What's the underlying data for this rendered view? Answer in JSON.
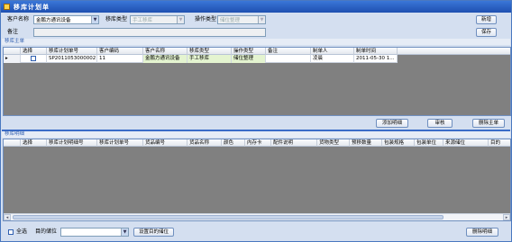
{
  "window": {
    "title": "移库计划单"
  },
  "form": {
    "customer_name_label": "客户名称",
    "customer_name_value": "金鹏方通讯设备",
    "move_type_label": "移库类型",
    "move_type_value": "手工移库",
    "op_type_label": "操作类型",
    "op_type_value": "储位整理",
    "remark_label": "备注",
    "remark_value": ""
  },
  "buttons": {
    "new": "新增",
    "save": "保存",
    "add_detail": "添加明细",
    "review": "审核",
    "delete_main": "删除主单",
    "set_target": "设置目的储位",
    "delete_detail": "删除明细"
  },
  "main_section": {
    "title": "移库主单"
  },
  "main_table": {
    "columns": [
      "选择",
      "移库计划单号",
      "客户编码",
      "客户名称",
      "移库类型",
      "操作类型",
      "备注",
      "制单人",
      "制单时间"
    ],
    "rows": [
      {
        "indicator": "▸",
        "checked": false,
        "plan_no": "SP2011053000002",
        "customer_code": "11",
        "customer_name": "金鹏方通讯设备",
        "move_type": "手工移库",
        "op_type": "储位整理",
        "remark": "",
        "creator": "凌晨",
        "created_at": "2011-05-30 1..."
      }
    ]
  },
  "detail_section": {
    "title": "移库明细"
  },
  "detail_table": {
    "columns": [
      "选择",
      "移库计划明细号",
      "移库计划单号",
      "货品编号",
      "货品名称",
      "颜色",
      "内存卡",
      "配件说明",
      "货物类型",
      "预移数量",
      "包装规格",
      "包装单位",
      "来源储位",
      "目的"
    ],
    "rows": []
  },
  "footer": {
    "select_all_label": "全选",
    "target_label": "目的储位",
    "target_value": ""
  }
}
